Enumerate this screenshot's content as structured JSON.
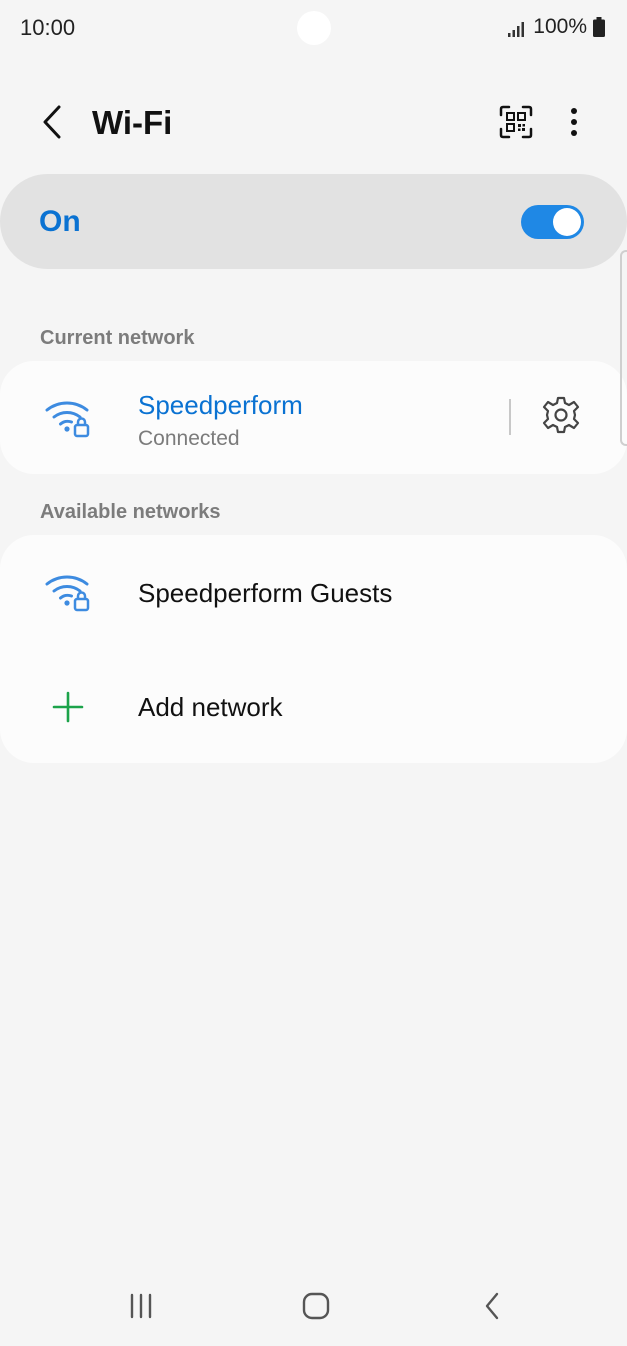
{
  "status_bar": {
    "time": "10:00",
    "battery": "100%",
    "icons": [
      "signal-icon",
      "battery-icon"
    ]
  },
  "header": {
    "title": "Wi-Fi",
    "icons": [
      "back-arrow-icon",
      "qr-code-icon",
      "more-vertical-icon"
    ]
  },
  "master_switch": {
    "label": "On",
    "state": "on",
    "accent_color": "#1f88e5",
    "label_color": "#0a72d2"
  },
  "current_network": {
    "section_label": "Current network",
    "name": "Speedperform",
    "status": "Connected",
    "icon": "wifi-locked-icon",
    "action_icon": "gear-icon"
  },
  "available_networks": {
    "section_label": "Available networks",
    "items": [
      {
        "name": "Speedperform Guests",
        "icon": "wifi-locked-icon"
      },
      {
        "name": "Add network",
        "icon": "plus-icon"
      }
    ],
    "add_icon_color": "#1ca34a"
  },
  "nav_bar": {
    "icons": [
      "recent-apps-icon",
      "home-icon",
      "nav-back-icon"
    ]
  }
}
